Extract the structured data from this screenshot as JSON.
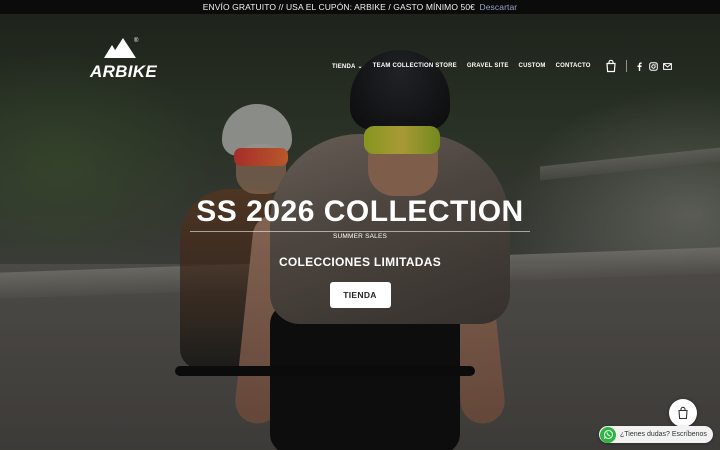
{
  "announcement": {
    "text": "ENVÍO GRATUITO // USA EL CUPÓN: ARBIKE / GASTO MÍNIMO 50€",
    "dismiss_label": "Descartar"
  },
  "brand": {
    "name": "ARBIKE",
    "registered_mark": "®"
  },
  "nav": {
    "items": [
      {
        "label": "TIENDA",
        "has_dropdown": true
      },
      {
        "label": "TEAM COLLECTION STORE"
      },
      {
        "label": "GRAVEL SITE"
      },
      {
        "label": "CUSTOM"
      },
      {
        "label": "CONTACTO"
      }
    ],
    "cart_icon": "shopping-bag-icon",
    "social_icons": [
      "facebook-icon",
      "instagram-icon",
      "email-icon"
    ]
  },
  "hero": {
    "title": "SS 2026 COLLECTION",
    "subtitle": "SUMMER SALES",
    "collections_label": "COLECCIONES LIMITADAS",
    "button_label": "TIENDA"
  },
  "floating": {
    "cart_icon": "shopping-bag-icon",
    "whatsapp_icon": "whatsapp-icon",
    "whatsapp_text": "¿Tienes dudas? Escríbenos"
  },
  "colors": {
    "announcement_bg": "#0b0b0b",
    "dismiss_link": "#9aa4c4",
    "whatsapp_green": "#2bb741",
    "button_bg": "#ffffff"
  }
}
